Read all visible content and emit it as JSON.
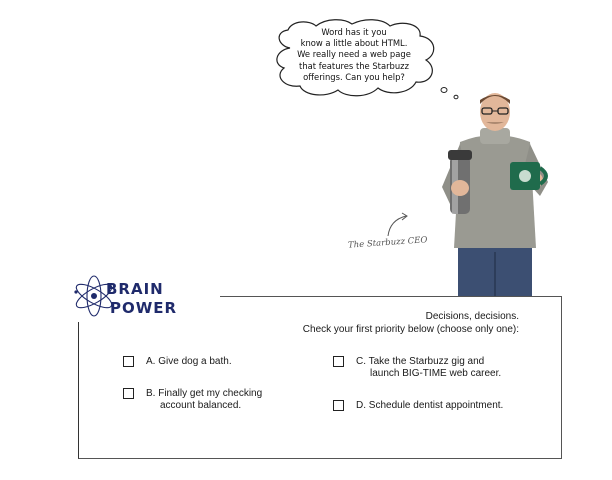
{
  "thought_bubble": {
    "lines": [
      "Word has it you",
      "know a little about HTML.",
      "We really need a web page",
      "that features the Starbuzz",
      "offerings. Can you help?"
    ]
  },
  "caption": "The Starbuzz CEO",
  "brain_power": {
    "line1": "BRAIN",
    "line2": "POWER"
  },
  "panel": {
    "title": "Decisions, decisions.",
    "subtitle": "Check your first priority below (choose only one):",
    "options": {
      "a": {
        "line1": "A. Give dog a bath."
      },
      "b": {
        "line1": "B. Finally get my checking",
        "line2": "account balanced."
      },
      "c": {
        "line1": "C. Take the Starbuzz gig and",
        "line2": "launch BIG-TIME web career."
      },
      "d": {
        "line1": "D. Schedule dentist appointment."
      }
    }
  },
  "colors": {
    "brain_power_text": "#1f2a6b",
    "mug_green": "#1f6b4c",
    "sweater": "#9a9a92",
    "jeans": "#3c4f72"
  }
}
